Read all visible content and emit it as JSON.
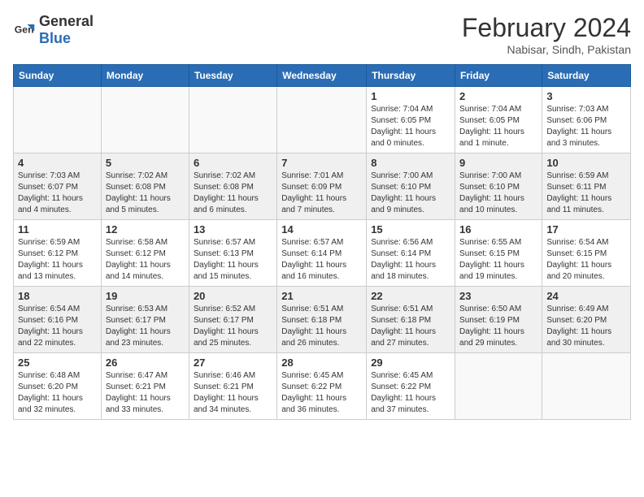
{
  "header": {
    "logo_general": "General",
    "logo_blue": "Blue",
    "month_title": "February 2024",
    "location": "Nabisar, Sindh, Pakistan"
  },
  "days_of_week": [
    "Sunday",
    "Monday",
    "Tuesday",
    "Wednesday",
    "Thursday",
    "Friday",
    "Saturday"
  ],
  "weeks": [
    [
      {
        "day": "",
        "info": ""
      },
      {
        "day": "",
        "info": ""
      },
      {
        "day": "",
        "info": ""
      },
      {
        "day": "",
        "info": ""
      },
      {
        "day": "1",
        "info": "Sunrise: 7:04 AM\nSunset: 6:05 PM\nDaylight: 11 hours and 0 minutes."
      },
      {
        "day": "2",
        "info": "Sunrise: 7:04 AM\nSunset: 6:05 PM\nDaylight: 11 hours and 1 minute."
      },
      {
        "day": "3",
        "info": "Sunrise: 7:03 AM\nSunset: 6:06 PM\nDaylight: 11 hours and 3 minutes."
      }
    ],
    [
      {
        "day": "4",
        "info": "Sunrise: 7:03 AM\nSunset: 6:07 PM\nDaylight: 11 hours and 4 minutes."
      },
      {
        "day": "5",
        "info": "Sunrise: 7:02 AM\nSunset: 6:08 PM\nDaylight: 11 hours and 5 minutes."
      },
      {
        "day": "6",
        "info": "Sunrise: 7:02 AM\nSunset: 6:08 PM\nDaylight: 11 hours and 6 minutes."
      },
      {
        "day": "7",
        "info": "Sunrise: 7:01 AM\nSunset: 6:09 PM\nDaylight: 11 hours and 7 minutes."
      },
      {
        "day": "8",
        "info": "Sunrise: 7:00 AM\nSunset: 6:10 PM\nDaylight: 11 hours and 9 minutes."
      },
      {
        "day": "9",
        "info": "Sunrise: 7:00 AM\nSunset: 6:10 PM\nDaylight: 11 hours and 10 minutes."
      },
      {
        "day": "10",
        "info": "Sunrise: 6:59 AM\nSunset: 6:11 PM\nDaylight: 11 hours and 11 minutes."
      }
    ],
    [
      {
        "day": "11",
        "info": "Sunrise: 6:59 AM\nSunset: 6:12 PM\nDaylight: 11 hours and 13 minutes."
      },
      {
        "day": "12",
        "info": "Sunrise: 6:58 AM\nSunset: 6:12 PM\nDaylight: 11 hours and 14 minutes."
      },
      {
        "day": "13",
        "info": "Sunrise: 6:57 AM\nSunset: 6:13 PM\nDaylight: 11 hours and 15 minutes."
      },
      {
        "day": "14",
        "info": "Sunrise: 6:57 AM\nSunset: 6:14 PM\nDaylight: 11 hours and 16 minutes."
      },
      {
        "day": "15",
        "info": "Sunrise: 6:56 AM\nSunset: 6:14 PM\nDaylight: 11 hours and 18 minutes."
      },
      {
        "day": "16",
        "info": "Sunrise: 6:55 AM\nSunset: 6:15 PM\nDaylight: 11 hours and 19 minutes."
      },
      {
        "day": "17",
        "info": "Sunrise: 6:54 AM\nSunset: 6:15 PM\nDaylight: 11 hours and 20 minutes."
      }
    ],
    [
      {
        "day": "18",
        "info": "Sunrise: 6:54 AM\nSunset: 6:16 PM\nDaylight: 11 hours and 22 minutes."
      },
      {
        "day": "19",
        "info": "Sunrise: 6:53 AM\nSunset: 6:17 PM\nDaylight: 11 hours and 23 minutes."
      },
      {
        "day": "20",
        "info": "Sunrise: 6:52 AM\nSunset: 6:17 PM\nDaylight: 11 hours and 25 minutes."
      },
      {
        "day": "21",
        "info": "Sunrise: 6:51 AM\nSunset: 6:18 PM\nDaylight: 11 hours and 26 minutes."
      },
      {
        "day": "22",
        "info": "Sunrise: 6:51 AM\nSunset: 6:18 PM\nDaylight: 11 hours and 27 minutes."
      },
      {
        "day": "23",
        "info": "Sunrise: 6:50 AM\nSunset: 6:19 PM\nDaylight: 11 hours and 29 minutes."
      },
      {
        "day": "24",
        "info": "Sunrise: 6:49 AM\nSunset: 6:20 PM\nDaylight: 11 hours and 30 minutes."
      }
    ],
    [
      {
        "day": "25",
        "info": "Sunrise: 6:48 AM\nSunset: 6:20 PM\nDaylight: 11 hours and 32 minutes."
      },
      {
        "day": "26",
        "info": "Sunrise: 6:47 AM\nSunset: 6:21 PM\nDaylight: 11 hours and 33 minutes."
      },
      {
        "day": "27",
        "info": "Sunrise: 6:46 AM\nSunset: 6:21 PM\nDaylight: 11 hours and 34 minutes."
      },
      {
        "day": "28",
        "info": "Sunrise: 6:45 AM\nSunset: 6:22 PM\nDaylight: 11 hours and 36 minutes."
      },
      {
        "day": "29",
        "info": "Sunrise: 6:45 AM\nSunset: 6:22 PM\nDaylight: 11 hours and 37 minutes."
      },
      {
        "day": "",
        "info": ""
      },
      {
        "day": "",
        "info": ""
      }
    ]
  ]
}
